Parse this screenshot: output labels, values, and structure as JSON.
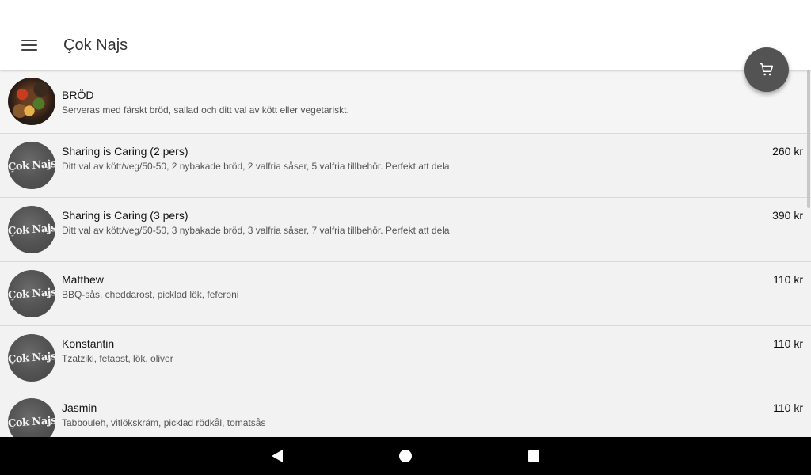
{
  "app": {
    "title": "Çok Najs",
    "logo_text": "Çok Najs"
  },
  "icons": {
    "menu": "hamburger-menu-icon",
    "cart": "shopping-cart-icon",
    "back": "back-triangle-icon",
    "home": "home-circle-icon",
    "recents": "recents-square-icon"
  },
  "colors": {
    "fab": "#535353",
    "appbar": "#ffffff",
    "list_bg": "#f2f2f2",
    "navbar": "#000000"
  },
  "category": {
    "name": "BRÖD",
    "description": "Serveras med färskt bröd, sallad och ditt val av kött eller vegetariskt."
  },
  "items": [
    {
      "name": "Sharing is Caring (2 pers)",
      "description": "Ditt val av kött/veg/50-50, 2 nybakade bröd, 2 valfria såser, 5 valfria tillbehör. Perfekt att dela",
      "price": "260 kr"
    },
    {
      "name": "Sharing is Caring (3 pers)",
      "description": "Ditt val av kött/veg/50-50, 3 nybakade bröd, 3 valfria såser, 7 valfria tillbehör. Perfekt att dela",
      "price": "390 kr"
    },
    {
      "name": "Matthew",
      "description": "BBQ-sås, cheddarost, picklad lök, feferoni",
      "price": "110 kr"
    },
    {
      "name": "Konstantin",
      "description": "Tzatziki, fetaost, lök, oliver",
      "price": "110 kr"
    },
    {
      "name": "Jasmin",
      "description": "Tabbouleh, vitlökskräm, picklad rödkål, tomatsås",
      "price": "110 kr"
    }
  ]
}
